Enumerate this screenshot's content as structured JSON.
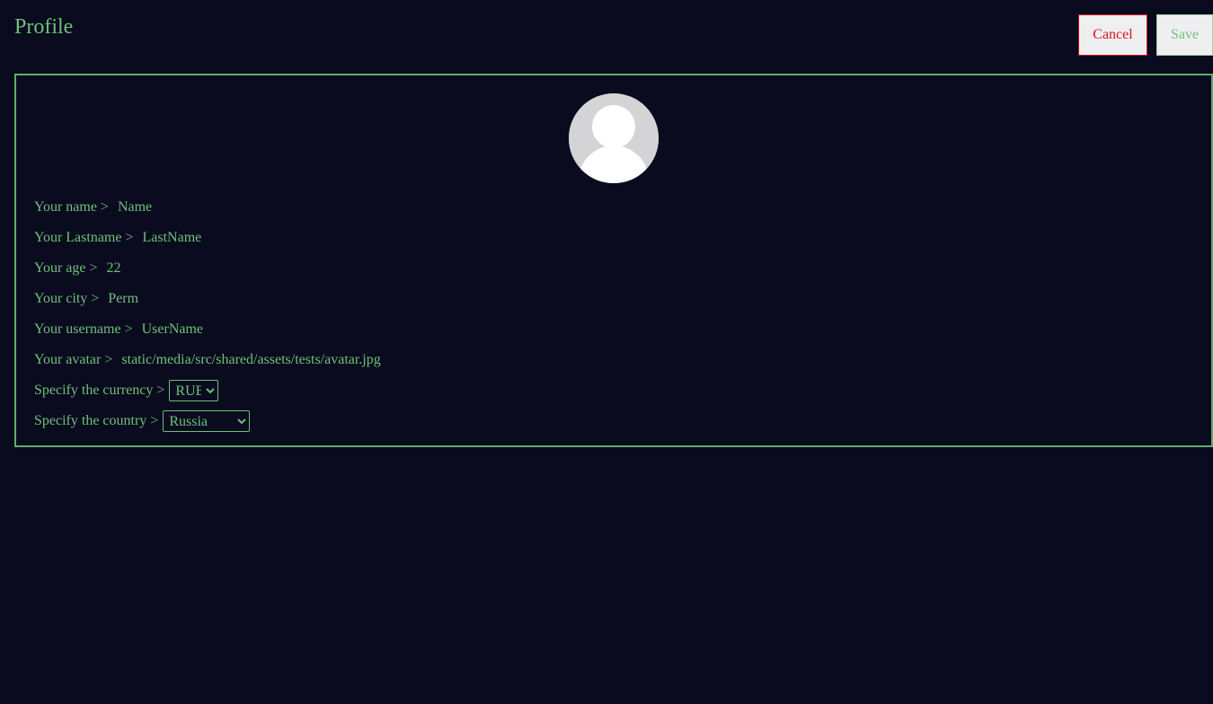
{
  "header": {
    "title": "Profile",
    "cancel_label": "Cancel",
    "save_label": "Save"
  },
  "profile": {
    "avatar_icon": "user-placeholder-icon",
    "fields": {
      "name": {
        "label": "Your name >",
        "value": "Name"
      },
      "lastname": {
        "label": "Your Lastname >",
        "value": "LastName"
      },
      "age": {
        "label": "Your age >",
        "value": "22"
      },
      "city": {
        "label": "Your city >",
        "value": "Perm"
      },
      "username": {
        "label": "Your username >",
        "value": "UserName"
      },
      "avatar": {
        "label": "Your avatar >",
        "value": "static/media/src/shared/assets/tests/avatar.jpg"
      }
    },
    "currency": {
      "label": "Specify the currency >",
      "selected": "RUB"
    },
    "country": {
      "label": "Specify the country >",
      "selected": "Russia"
    }
  },
  "colors": {
    "background": "#0a0b1e",
    "accent": "#6fbf7a",
    "danger": "#d4141c"
  }
}
